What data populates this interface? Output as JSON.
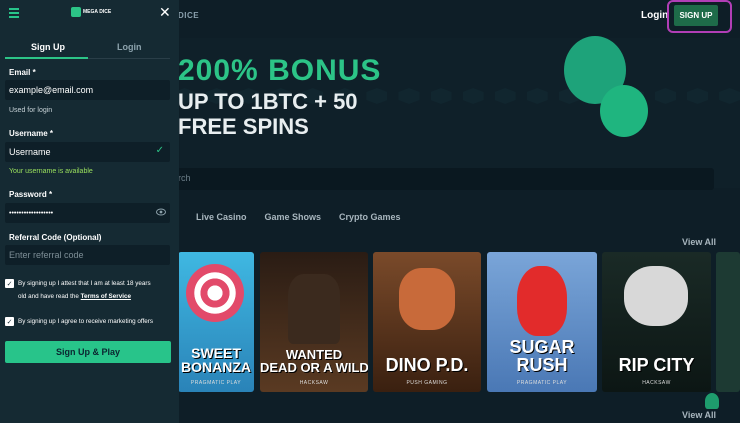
{
  "background_page": {
    "nav_item": "DICE",
    "login_label": "Login",
    "signup_label": "SIGN UP",
    "hero": {
      "line1": "200% BONUS",
      "line2": "UP TO 1BTC + 50",
      "line3": "FREE SPINS"
    },
    "search_placeholder": "rch",
    "tabs": [
      "Live Casino",
      "Game Shows",
      "Crypto Games"
    ],
    "view_all": "View All",
    "games": [
      {
        "title": "SWEET\nBONANZA",
        "provider": "PRAGMATIC PLAY"
      },
      {
        "title": "WANTED\nDEAD OR A WILD",
        "provider": "HACKSAW"
      },
      {
        "title": "DINO P.D.",
        "provider": "PUSH GAMING"
      },
      {
        "title": "SUGAR RUSH",
        "provider": "PRAGMATIC PLAY"
      },
      {
        "title": "RIP CITY",
        "provider": "HACKSAW"
      }
    ]
  },
  "panel": {
    "logo_text": "MEGA DICE",
    "tabs": {
      "signup": "Sign Up",
      "login": "Login"
    },
    "email": {
      "label": "Email *",
      "value": "example@email.com",
      "hint": "Used for login"
    },
    "username": {
      "label": "Username *",
      "value": "Username",
      "status": "Your username is available"
    },
    "password": {
      "label": "Password *",
      "value": "••••••••••••••••••"
    },
    "referral": {
      "label": "Referral Code (Optional)",
      "placeholder": "Enter referral code"
    },
    "consent1": {
      "text_a": "By signing up I attest that I am at least 18 years",
      "text_b": "old and have read the ",
      "link": "Terms of Service"
    },
    "consent2": {
      "text": "By signing up I agree to receive marketing offers"
    },
    "submit_label": "Sign Up & Play"
  },
  "colors": {
    "accent": "#28c48a",
    "panel_bg": "#152a33",
    "highlight_border": "#b13eb6",
    "success_text": "#9be15d"
  }
}
